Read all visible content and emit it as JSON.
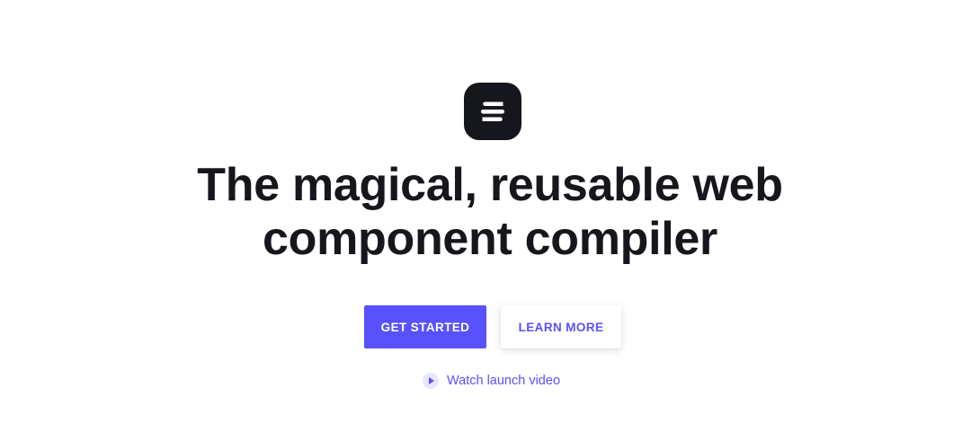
{
  "hero": {
    "logo_icon": "stencil-logo-icon",
    "title_line1": "The magical, reusable web",
    "title_line2": "component compiler",
    "primary_button_label": "GET STARTED",
    "secondary_button_label": "LEARN MORE",
    "video_link_label": "Watch launch video",
    "video_icon": "play-icon"
  },
  "colors": {
    "accent": "#5851ff",
    "text": "#16161d",
    "logo_bg": "#16161d",
    "background": "#ffffff"
  }
}
